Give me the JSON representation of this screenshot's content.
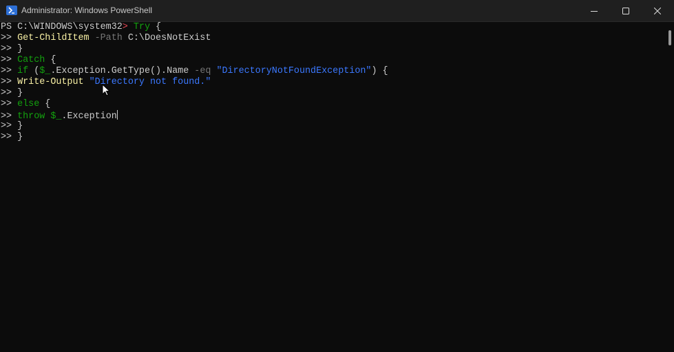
{
  "window": {
    "title": "Administrator: Windows PowerShell",
    "icon": "powershell-icon"
  },
  "colors": {
    "default": "#cccccc",
    "command": "#f9f1a5",
    "keyword": "#13a10e",
    "string": "#3b78ff",
    "parameter": "#767676",
    "prompt_arrow": "#e74856",
    "background": "#0c0c0c"
  },
  "terminal": {
    "lines": [
      [
        {
          "t": "PS C:\\WINDOWS\\system32",
          "c": "default"
        },
        {
          "t": "> ",
          "c": "prompt_arrow"
        },
        {
          "t": "Try",
          "c": "keyword"
        },
        {
          "t": " {",
          "c": "default"
        }
      ],
      [
        {
          "t": ">> ",
          "c": "default"
        },
        {
          "t": "Get-ChildItem",
          "c": "command"
        },
        {
          "t": " -Path",
          "c": "parameter"
        },
        {
          "t": " C:\\DoesNotExist",
          "c": "default"
        }
      ],
      [
        {
          "t": ">> }",
          "c": "default"
        }
      ],
      [
        {
          "t": ">> ",
          "c": "default"
        },
        {
          "t": "Catch",
          "c": "keyword"
        },
        {
          "t": " {",
          "c": "default"
        }
      ],
      [
        {
          "t": ">> ",
          "c": "default"
        },
        {
          "t": "if",
          "c": "keyword"
        },
        {
          "t": " (",
          "c": "default"
        },
        {
          "t": "$_",
          "c": "keyword"
        },
        {
          "t": ".Exception.GetType().Name ",
          "c": "default"
        },
        {
          "t": "-eq",
          "c": "parameter"
        },
        {
          "t": " ",
          "c": "default"
        },
        {
          "t": "\"DirectoryNotFoundException\"",
          "c": "string"
        },
        {
          "t": ") {",
          "c": "default"
        }
      ],
      [
        {
          "t": ">> ",
          "c": "default"
        },
        {
          "t": "Write-Output",
          "c": "command"
        },
        {
          "t": " ",
          "c": "default"
        },
        {
          "t": "\"Directory not found.\"",
          "c": "string"
        }
      ],
      [
        {
          "t": ">> }",
          "c": "default"
        }
      ],
      [
        {
          "t": ">> ",
          "c": "default"
        },
        {
          "t": "else",
          "c": "keyword"
        },
        {
          "t": " {",
          "c": "default"
        }
      ],
      [
        {
          "t": ">> ",
          "c": "default"
        },
        {
          "t": "throw",
          "c": "keyword"
        },
        {
          "t": " ",
          "c": "default"
        },
        {
          "t": "$_",
          "c": "keyword"
        },
        {
          "t": ".Exception",
          "c": "default"
        }
      ],
      [
        {
          "t": ">> }",
          "c": "default"
        }
      ],
      [
        {
          "t": ">> }",
          "c": "default"
        }
      ]
    ],
    "cursor_line": 8
  }
}
